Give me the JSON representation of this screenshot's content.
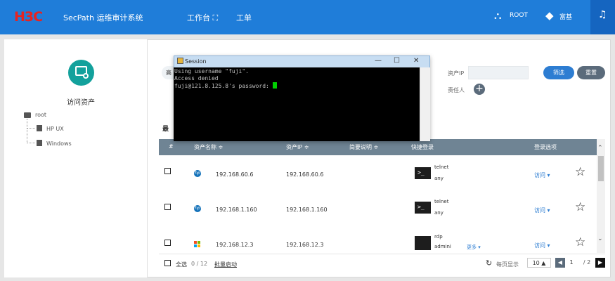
{
  "header": {
    "logo": "H3C",
    "app_title": "SecPath 运维审计系统",
    "nav": [
      {
        "label": "工作台 ⛶"
      },
      {
        "label": "工单"
      }
    ],
    "user_root": "ROOT",
    "user_rich": "富基"
  },
  "left": {
    "asset_label": "访问资产",
    "tree": {
      "root": "root",
      "children": [
        "HP UX",
        "Windows"
      ]
    }
  },
  "filters": {
    "partial_button": "高",
    "asset_ip_label": "资产IP",
    "responsible_label": "责任人",
    "filter_button": "筛选",
    "reset_button": "重置",
    "recent_partial": "最"
  },
  "table": {
    "columns": [
      "#",
      "资产名称 ≑",
      "资产IP ≑",
      "简要说明 ≑",
      "快捷登录",
      "登录选项"
    ],
    "rows": [
      {
        "icon": "hp-icon",
        "name": "192.168.60.6",
        "ip": "192.168.60.6",
        "protocol": "telnet",
        "account": "any",
        "visit": "访问 ▾"
      },
      {
        "icon": "hp-icon",
        "name": "192.168.1.160",
        "ip": "192.168.1.160",
        "protocol": "telnet",
        "account": "any",
        "visit": "访问 ▾"
      },
      {
        "icon": "windows-icon",
        "name": "192.168.12.3",
        "ip": "192.168.12.3",
        "protocol": "rdp",
        "account": "admini",
        "more": "更多 ▾",
        "visit": "访问 ▾"
      }
    ]
  },
  "footer": {
    "select_all": "全选",
    "count": "0 / 12",
    "batch_start": "批量启动",
    "per_page_label": "每页显示",
    "per_page_value": "10 ▲",
    "page_current": "1",
    "page_total": "/ 2"
  },
  "session": {
    "title": "Session",
    "lines": [
      "Using username \"fuji\".",
      "Access denied",
      "fuji@121.8.125.8's password: "
    ]
  },
  "colors": {
    "topbar": "#1f7dd9",
    "accent": "#2d7dd2",
    "asset_circle": "#13a19c",
    "table_header": "#6f8494"
  }
}
